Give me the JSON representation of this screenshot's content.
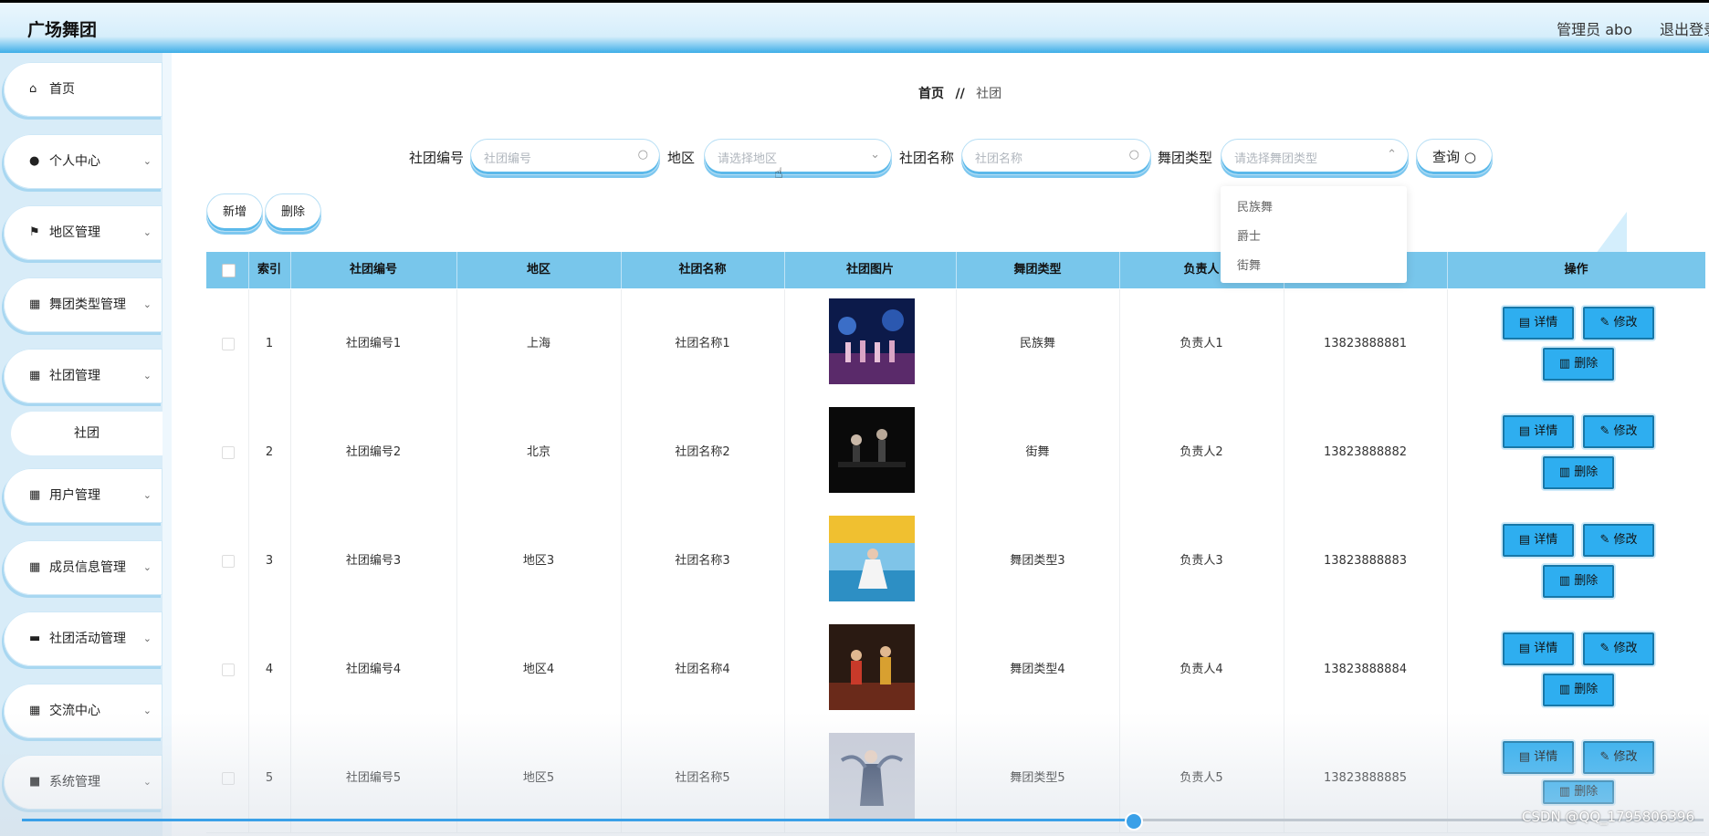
{
  "app": {
    "title": "广场舞团",
    "admin": "管理员 abo",
    "logout": "退出登录"
  },
  "sidebar": {
    "items": [
      {
        "label": "首页",
        "icon": "home-icon",
        "expandable": false
      },
      {
        "label": "个人中心",
        "icon": "user-icon",
        "expandable": true
      },
      {
        "label": "地区管理",
        "icon": "flag-icon",
        "expandable": true
      },
      {
        "label": "舞团类型管理",
        "icon": "grid-icon",
        "expandable": true
      },
      {
        "label": "社团管理",
        "icon": "grid-icon",
        "expandable": true
      },
      {
        "label": "用户管理",
        "icon": "grid-icon",
        "expandable": true
      },
      {
        "label": "成员信息管理",
        "icon": "grid-icon",
        "expandable": true
      },
      {
        "label": "社团活动管理",
        "icon": "monitor-icon",
        "expandable": true
      },
      {
        "label": "交流中心",
        "icon": "grid-icon",
        "expandable": true
      },
      {
        "label": "系统管理",
        "icon": "briefcase-icon",
        "expandable": true
      }
    ],
    "subitem": "社团"
  },
  "breadcrumb": {
    "home": "首页",
    "separator": "//",
    "current": "社团"
  },
  "search": {
    "club_no": {
      "label": "社团编号",
      "placeholder": "社团编号"
    },
    "region": {
      "label": "地区",
      "placeholder": "请选择地区"
    },
    "club_name": {
      "label": "社团名称",
      "placeholder": "社团名称"
    },
    "dance_type": {
      "label": "舞团类型",
      "placeholder": "请选择舞团类型",
      "options": [
        "民族舞",
        "爵士",
        "街舞"
      ]
    },
    "query": "查询"
  },
  "actions": {
    "add": "新增",
    "delete": "删除"
  },
  "table": {
    "headers": [
      "索引",
      "社团编号",
      "地区",
      "社团名称",
      "社团图片",
      "舞团类型",
      "负责人",
      "",
      "操作"
    ],
    "rows": [
      {
        "index": "1",
        "club_no": "社团编号1",
        "region": "上海",
        "name": "社团名称1",
        "type": "民族舞",
        "leader": "负责人1",
        "phone": "13823888881"
      },
      {
        "index": "2",
        "club_no": "社团编号2",
        "region": "北京",
        "name": "社团名称2",
        "type": "街舞",
        "leader": "负责人2",
        "phone": "13823888882"
      },
      {
        "index": "3",
        "club_no": "社团编号3",
        "region": "地区3",
        "name": "社团名称3",
        "type": "舞团类型3",
        "leader": "负责人3",
        "phone": "13823888883"
      },
      {
        "index": "4",
        "club_no": "社团编号4",
        "region": "地区4",
        "name": "社团名称4",
        "type": "舞团类型4",
        "leader": "负责人4",
        "phone": "13823888884"
      },
      {
        "index": "5",
        "club_no": "社团编号5",
        "region": "地区5",
        "name": "社团名称5",
        "type": "舞团类型5",
        "leader": "负责人5",
        "phone": "13823888885"
      }
    ],
    "row_actions": {
      "detail": "详情",
      "edit": "修改",
      "delete": "删除"
    }
  },
  "video": {
    "progress": 0.66
  },
  "watermark": "CSDN @QQ_1795806396",
  "colors": {
    "accent": "#2eaef0",
    "header": "#78c6eb",
    "sidebar": "#d8ecf8"
  }
}
